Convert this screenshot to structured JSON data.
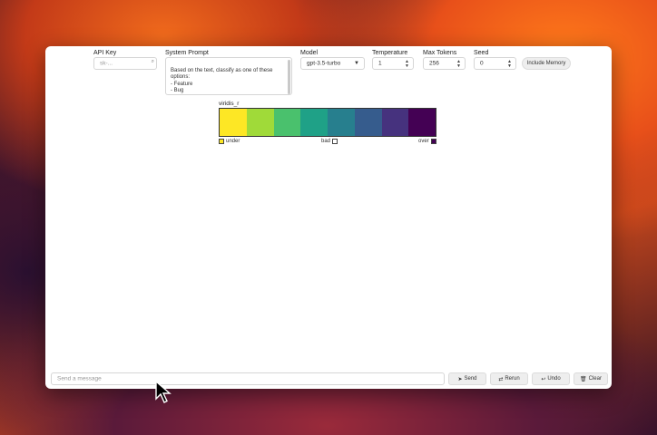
{
  "controls": {
    "api_key_label": "API Key",
    "api_key_placeholder": "sk-...",
    "system_prompt_label": "System Prompt",
    "system_prompt_value": "Based on the text, classify as one of these options:\n- Feature\n- Bug\n- Docs\n- Answer in one word no other options are",
    "model_label": "Model",
    "model_value": "gpt-3.5-turbo",
    "temperature_label": "Temperature",
    "temperature_value": "1",
    "max_tokens_label": "Max Tokens",
    "max_tokens_value": "256",
    "seed_label": "Seed",
    "seed_value": "0",
    "include_memory_label": "Include Memory"
  },
  "colormap": {
    "name": "viridis_r",
    "colors": [
      "#fde725",
      "#a0da39",
      "#4ac16d",
      "#1fa187",
      "#277f8e",
      "#365c8d",
      "#46327e",
      "#440154"
    ],
    "under_label": "under",
    "bad_label": "bad",
    "over_label": "over",
    "under_color": "#fde725",
    "bad_color": "#ffffff",
    "over_color": "#440154"
  },
  "footer": {
    "message_placeholder": "Send a message",
    "send_label": "Send",
    "rerun_label": "Rerun",
    "undo_label": "Undo",
    "clear_label": "Clear"
  }
}
